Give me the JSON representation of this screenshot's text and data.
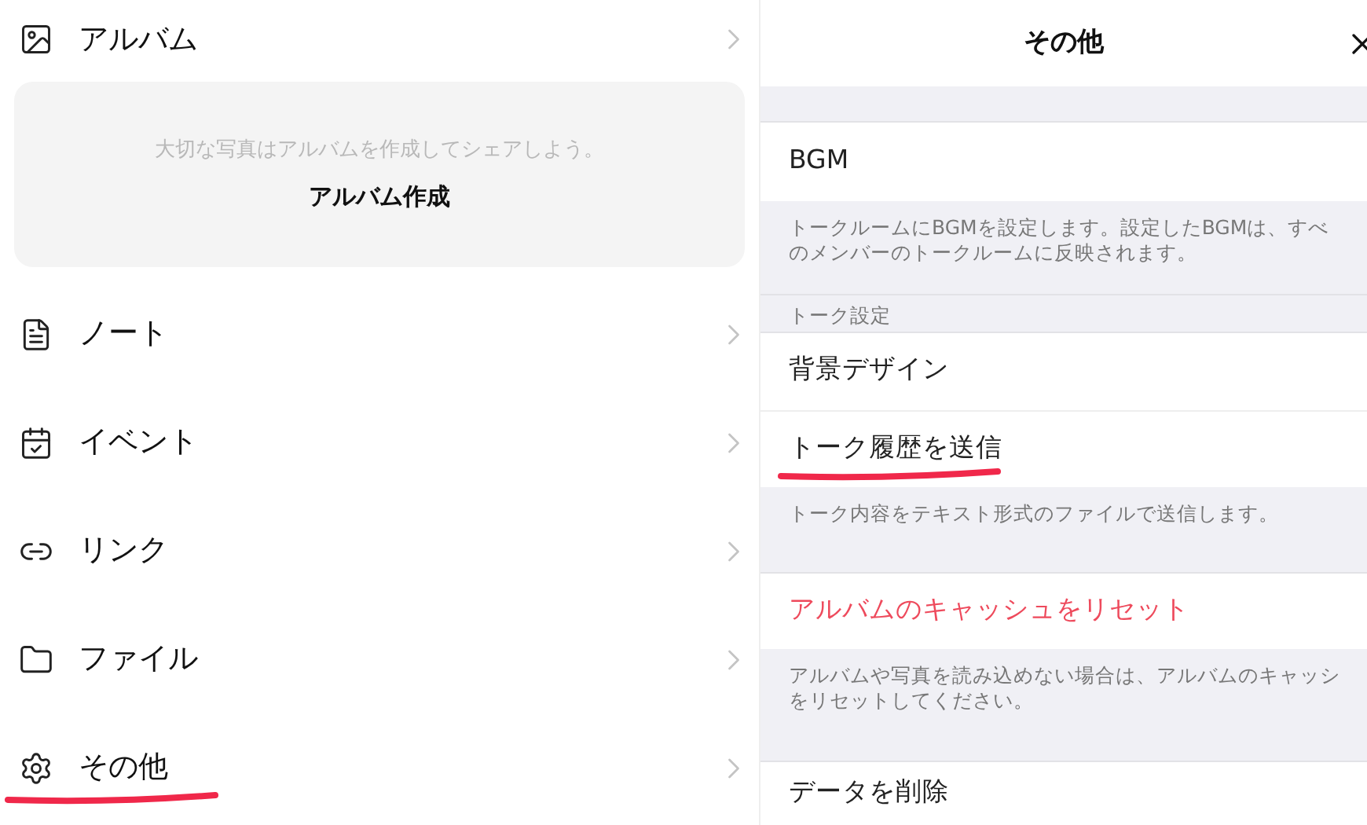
{
  "left_panel": {
    "items": [
      {
        "kind": "row",
        "label": "アルバム",
        "highlighted": false
      },
      {
        "kind": "card",
        "message": "大切な写真はアルバムを作成してシェアしよう。",
        "button": "アルバム作成"
      },
      {
        "kind": "row",
        "label": "ノート",
        "highlighted": false
      },
      {
        "kind": "row",
        "label": "イベント",
        "highlighted": false
      },
      {
        "kind": "row",
        "label": "リンク",
        "highlighted": false
      },
      {
        "kind": "row",
        "label": "ファイル",
        "highlighted": false
      },
      {
        "kind": "row",
        "label": "その他",
        "highlighted": true
      }
    ]
  },
  "right_panel": {
    "title": "その他",
    "items": [
      {
        "kind": "spacer"
      },
      {
        "kind": "item",
        "label": "BGM",
        "danger": false,
        "highlighted": false
      },
      {
        "kind": "note",
        "lines": [
          "トークルームにBGMを設定します。設定したBGMは、すべ",
          "のメンバーのトークルームに反映されます。"
        ]
      },
      {
        "kind": "section",
        "label": "トーク設定"
      },
      {
        "kind": "item",
        "label": "背景デザイン",
        "danger": false,
        "highlighted": false
      },
      {
        "kind": "item",
        "label": "トーク履歴を送信",
        "danger": false,
        "highlighted": true
      },
      {
        "kind": "note",
        "lines": [
          "トーク内容をテキスト形式のファイルで送信します。"
        ]
      },
      {
        "kind": "item",
        "label": "アルバムのキャッシュをリセット",
        "danger": true,
        "highlighted": false
      },
      {
        "kind": "note",
        "lines": [
          "アルバムや写真を読み込めない場合は、アルバムのキャッシ",
          "をリセットしてください。"
        ]
      },
      {
        "kind": "item",
        "label": "データを削除",
        "danger": false,
        "highlighted": false
      }
    ]
  }
}
